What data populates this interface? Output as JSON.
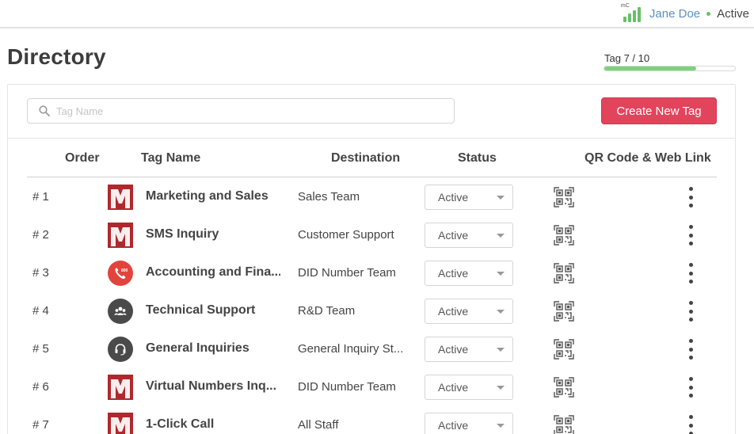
{
  "user": {
    "brand": "mC",
    "name": "Jane Doe",
    "status": "Active"
  },
  "page": {
    "title": "Directory"
  },
  "tag_usage": {
    "label": "Tag 7 / 10",
    "used": 7,
    "total": 10,
    "fraction": 0.7
  },
  "search": {
    "placeholder": "Tag Name",
    "value": ""
  },
  "create_button": {
    "label": "Create New Tag"
  },
  "columns": {
    "order": "Order",
    "tag_name": "Tag Name",
    "destination": "Destination",
    "status": "Status",
    "qr": "QR Code & Web Link"
  },
  "colors": {
    "accent": "#e2445c",
    "progress": "#7ed07a",
    "user_link": "#5b8fc0",
    "status_dot": "#6abf69"
  },
  "rows": [
    {
      "order": "# 1",
      "icon": "m-logo",
      "name": "Marketing and Sales",
      "destination": "Sales Team",
      "status": "Active"
    },
    {
      "order": "# 2",
      "icon": "m-logo",
      "name": "SMS Inquiry",
      "destination": "Customer Support",
      "status": "Active"
    },
    {
      "order": "# 3",
      "icon": "800-phone-icon",
      "name": "Accounting and Fina...",
      "destination": "DID Number Team",
      "status": "Active"
    },
    {
      "order": "# 4",
      "icon": "group-icon",
      "name": "Technical Support",
      "destination": "R&D Team",
      "status": "Active"
    },
    {
      "order": "# 5",
      "icon": "headset-icon",
      "name": "General Inquiries",
      "destination": "General Inquiry St...",
      "status": "Active"
    },
    {
      "order": "# 6",
      "icon": "m-logo",
      "name": "Virtual Numbers Inq...",
      "destination": "DID Number Team",
      "status": "Active"
    },
    {
      "order": "# 7",
      "icon": "m-logo",
      "name": "1-Click Call",
      "destination": "All Staff",
      "status": "Active"
    }
  ]
}
